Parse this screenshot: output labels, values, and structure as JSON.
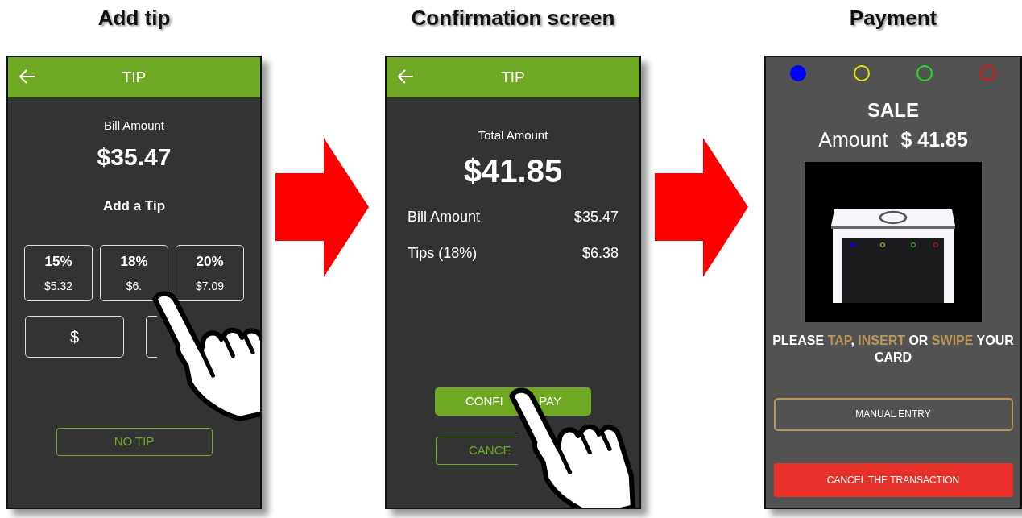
{
  "panels": [
    {
      "title": "Add tip",
      "kind": "tip",
      "header": {
        "title": "TIP"
      },
      "bill_label": "Bill Amount",
      "bill_amount": "$35.47",
      "add_tip_label": "Add a Tip",
      "tip_options": [
        {
          "percent": "15%",
          "amount": "$5.32"
        },
        {
          "percent": "18%",
          "amount": "$6."
        },
        {
          "percent": "20%",
          "amount": "$7.09"
        }
      ],
      "custom_buttons": [
        {
          "label": "$"
        }
      ],
      "no_tip_button": "NO TIP",
      "hand": true
    },
    {
      "title": "Confirmation screen",
      "kind": "confirm",
      "header": {
        "title": "TIP"
      },
      "total_label": "Total Amount",
      "total_amount": "$41.85",
      "lines": [
        {
          "label": "Bill Amount",
          "value": "$35.47"
        },
        {
          "label": "Tips (18%)",
          "value": "$6.38"
        }
      ],
      "confirm_button": [
        "CONFI",
        "PAY"
      ],
      "cancel_button": "CANCE",
      "hand": true
    },
    {
      "title": "Payment",
      "kind": "payment",
      "lights": [
        {
          "color": "#0000ff",
          "on": true
        },
        {
          "color": "#e8e800",
          "on": false
        },
        {
          "color": "#22dd22",
          "on": false
        },
        {
          "color": "#ee1111",
          "on": false
        }
      ],
      "sale_label": "SALE",
      "amount_label": "Amount",
      "amount_value": "$ 41.85",
      "prompt": [
        {
          "text": "PLEASE ",
          "highlight": false
        },
        {
          "text": "TAP",
          "highlight": true
        },
        {
          "text": ", ",
          "highlight": false
        },
        {
          "text": "INSERT",
          "highlight": true
        },
        {
          "text": " OR ",
          "highlight": false
        },
        {
          "text": "SWIPE",
          "highlight": true
        },
        {
          "text": " YOUR CARD",
          "highlight": false
        }
      ],
      "manual_entry_button": "MANUAL ENTRY",
      "cancel_button": "CANCEL THE TRANSACTION"
    }
  ]
}
